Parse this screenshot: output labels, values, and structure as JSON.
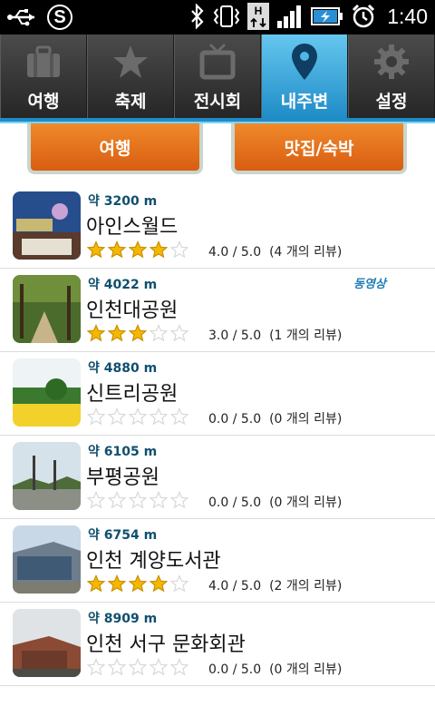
{
  "status_bar": {
    "time": "1:40",
    "icons": [
      "usb-icon",
      "skype-icon",
      "bluetooth-icon",
      "vibrate-icon",
      "hspa-icon",
      "signal-icon",
      "battery-charging-icon",
      "alarm-icon"
    ]
  },
  "tabs": [
    {
      "label": "여행",
      "icon": "suitcase-icon",
      "active": false
    },
    {
      "label": "축제",
      "icon": "star-icon",
      "active": false
    },
    {
      "label": "전시회",
      "icon": "tv-icon",
      "active": false
    },
    {
      "label": "내주변",
      "icon": "location-pin-icon",
      "active": true
    },
    {
      "label": "설정",
      "icon": "gear-icon",
      "active": false
    }
  ],
  "sub_buttons": {
    "travel": "여행",
    "food_stay": "맛집/숙박"
  },
  "colors": {
    "tab_active": "#1f8cc7",
    "button_orange": "#e3701c",
    "distance_text": "#0f4f6e",
    "star_on": "#f5b800"
  },
  "places": [
    {
      "distance": "약 3200 m",
      "name": "아인스월드",
      "rating_value": 4.0,
      "rating_text": "4.0 / 5.0",
      "reviews": "(4 개의 리뷰)",
      "badge": ""
    },
    {
      "distance": "약 4022 m",
      "name": "인천대공원",
      "rating_value": 3.0,
      "rating_text": "3.0 / 5.0",
      "reviews": "(1 개의 리뷰)",
      "badge": "동영상"
    },
    {
      "distance": "약 4880 m",
      "name": "신트리공원",
      "rating_value": 0.0,
      "rating_text": "0.0 / 5.0",
      "reviews": "(0 개의 리뷰)",
      "badge": ""
    },
    {
      "distance": "약 6105 m",
      "name": "부평공원",
      "rating_value": 0.0,
      "rating_text": "0.0 / 5.0",
      "reviews": "(0 개의 리뷰)",
      "badge": ""
    },
    {
      "distance": "약 6754 m",
      "name": "인천 계양도서관",
      "rating_value": 4.0,
      "rating_text": "4.0 / 5.0",
      "reviews": "(2 개의 리뷰)",
      "badge": ""
    },
    {
      "distance": "약 8909 m",
      "name": "인천 서구 문화회관",
      "rating_value": 0.0,
      "rating_text": "0.0 / 5.0",
      "reviews": "(0 개의 리뷰)",
      "badge": ""
    }
  ]
}
